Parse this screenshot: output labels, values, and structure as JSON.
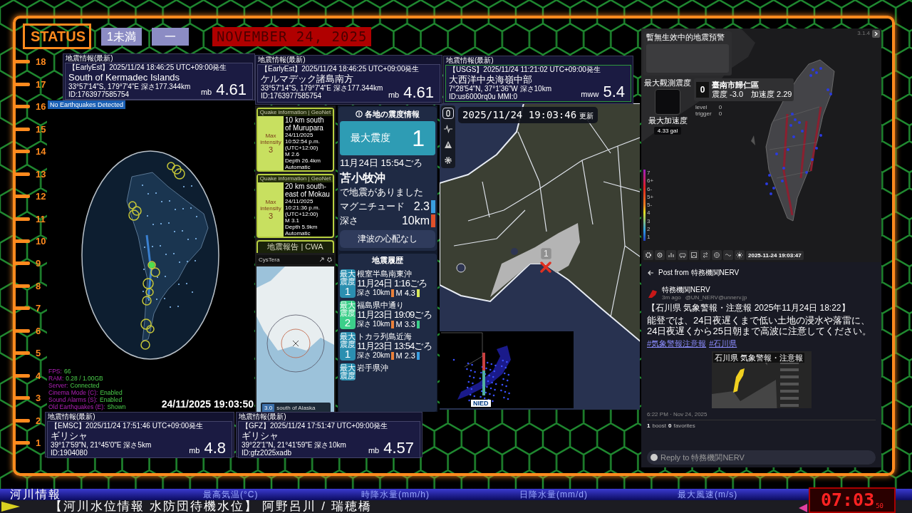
{
  "status": {
    "label": "STATUS",
    "badges": [
      "1未満",
      "一"
    ],
    "date": "NOVEMBER 24, 2025"
  },
  "scale": [
    "18",
    "17",
    "16",
    "15",
    "14",
    "13",
    "12",
    "11",
    "10",
    "9",
    "8",
    "7",
    "6",
    "5",
    "4",
    "3",
    "2",
    "1"
  ],
  "quake_cards": [
    {
      "header": "地震情報(最新)",
      "source_line": "【EarlyEst】2025/11/24 18:46:25 UTC+09:00発生",
      "place": "South of Kermadec Islands",
      "coords": "33°57'14\"S, 179°7'4\"E 深さ177.344km",
      "id": "ID:1763977585754",
      "mag_type": "mb",
      "magnitude": "4.61",
      "highlighted": false
    },
    {
      "header": "地震情報(最新)",
      "source_line": "【EarlyEst】2025/11/24 18:46:25 UTC+09:00発生",
      "place": "ケルマデック諸島南方",
      "coords": "33°57'14\"S, 179°7'4\"E 深さ177.344km",
      "id": "ID:1763977585754",
      "mag_type": "mb",
      "magnitude": "4.61",
      "highlighted": false
    },
    {
      "header": "地震情報(最新)",
      "source_line": "【USGS】2025/11/24 11:21:02 UTC+09:00発生",
      "place": "大西洋中央海嶺中部",
      "coords": "7°28'54\"N, 37°1'36\"W 深さ10km",
      "id": "ID:us6000rq0u MMI:0",
      "mag_type": "mww",
      "magnitude": "5.4",
      "highlighted": true
    },
    {
      "header": "地震情報(最新)",
      "source_line": "【EMSC】2025/11/24 17:51:46 UTC+09:00発生",
      "place": "ギリシャ",
      "coords": "39°17'59\"N, 21°45'0\"E 深さ5km",
      "id": "ID:1904080",
      "mag_type": "mb",
      "magnitude": "4.8",
      "highlighted": false
    },
    {
      "header": "地震情報(最新)",
      "source_line": "【GFZ】2025/11/24 17:51:47 UTC+09:00発生",
      "place": "ギリシャ",
      "coords": "39°22'1\"N, 21°41'59\"E 深さ10km",
      "id": "ID:gfz2025xadb",
      "mag_type": "mb",
      "magnitude": "4.57",
      "highlighted": false
    }
  ],
  "globe": {
    "badge": "No Earthquakes Detected",
    "stats": [
      {
        "label": "FPS:",
        "value": "66"
      },
      {
        "label": "RAM:",
        "value": "0.28 / 1.00GB"
      },
      {
        "label": "Server:",
        "value": "Connected"
      },
      {
        "label": "Cinema Mode (C):",
        "value": "Enabled"
      },
      {
        "label": "Sound Alarms (S):",
        "value": "Enabled"
      },
      {
        "label": "Old Earthquakes (E):",
        "value": "Shown"
      }
    ],
    "timestamp": "24/11/2025 19:03:50"
  },
  "geonet": {
    "cards": [
      {
        "header": "Quake information | GeoNet",
        "intensity_label": "Max intensity",
        "intensity": "3",
        "title": "10 km south of Murupara",
        "datetime": "24/11/2025 10:52:54 p.m.",
        "utc": "(UTC+12:00)",
        "magnitude": "M 2.6",
        "depth": "Depth 26.4km",
        "mode": "Automatic"
      },
      {
        "header": "Quake information | GeoNet",
        "intensity_label": "Max intensity",
        "intensity": "3",
        "title": "20 km south-east of Mokau",
        "datetime": "24/11/2025 10:21:36 p.m.",
        "utc": "(UTC+12:00)",
        "magnitude": "M 3.1",
        "depth": "Depth 5.9km",
        "mode": "Automatic"
      }
    ],
    "cwa_header": "地震報告 | CWA",
    "app_name": "CysTera",
    "map_label": "south of Alaska",
    "map_value": "3.0"
  },
  "jma": {
    "title": "各地の震度情報",
    "max_label": "最大震度",
    "max_value": "1",
    "time": "11月24日 15:54ごろ",
    "place": "苫小牧沖",
    "note": "で地震がありました",
    "magnitude_label": "マグニチュード",
    "magnitude": "2.3",
    "depth_label": "深さ",
    "depth": "10km",
    "tsunami": "津波の心配なし",
    "history_title": "地震履歴",
    "history": [
      {
        "badge_label": "最大震度",
        "intensity": "1",
        "color": "#2b8fb0",
        "place": "根室半島南東沖",
        "time": "11月24日 1:16ごろ",
        "depth_label": "深さ",
        "depth": "10km",
        "magnitude": "M 4.3",
        "mag_bar": {
          "color": "#d8e85a"
        }
      },
      {
        "badge_label": "最大震度",
        "intensity": "2",
        "color": "#3ccf8a",
        "place": "福島県中通り",
        "time": "11月23日 19:09ごろ",
        "depth_label": "深さ",
        "depth": "10km",
        "magnitude": "M 3.3",
        "mag_bar": {
          "color": "#3ccf8a"
        }
      },
      {
        "badge_label": "最大震度",
        "intensity": "1",
        "color": "#2b8fb0",
        "place": "トカラ列島近海",
        "time": "11月23日 13:54ごろ",
        "depth_label": "深さ",
        "depth": "20km",
        "magnitude": "M 2.3",
        "mag_bar": {
          "color": "#3a9ee0"
        }
      },
      {
        "badge_label": "最大震度",
        "color": "#2b8fb0",
        "place": "岩手県沖"
      }
    ]
  },
  "hokkaido": {
    "timestamp": "2025/11/24 19:03:46",
    "updated": "更新",
    "tools": [
      {
        "selected": true
      },
      {
        "selected": false
      },
      {
        "selected": false
      },
      {
        "selected": false
      }
    ],
    "marker_intensity": "1",
    "inset_brand": "NIED"
  },
  "taiwan": {
    "alert_title": "暫無生效中的地震預警",
    "version": "3.1.4",
    "max_intensity_label": "最大觀測震度",
    "station_intensity": "0",
    "station": "臺南市歸仁區",
    "station_detail": "震度 -3.0　加速度 2.29",
    "level_label": "level",
    "level_value": "0",
    "trigger_label": "trigger",
    "trigger_value": "0",
    "max_accel_label": "最大加速度",
    "max_accel": "4.33 gal",
    "legend": [
      "7",
      "6+",
      "6-",
      "5+",
      "5-",
      "4",
      "3",
      "2",
      "1"
    ],
    "timestamp": "2025-11-24 19:03:47"
  },
  "post": {
    "header": "Post from 特務機関NERV",
    "author": "特務機関NERV",
    "meta": "3m ago",
    "handle": "@UN_NERV@unnerv.jp",
    "title": "【石川県 気象警報・注意報 2025年11月24日 18:22】",
    "body": "能登では、24日夜遅くまで低い土地の浸水や落雷に、24日夜遅くから25日朝まで高波に注意してください。",
    "tags": [
      "#気象警報注意報",
      "#石川県"
    ],
    "image_title": "石川県 気象警報・注意報",
    "footer_time": "6:22 PM · Nov 24, 2025",
    "boosts": "1",
    "boosts_label": "boost",
    "favorites": "0",
    "favorites_label": "favorites",
    "reply_placeholder": "Reply to 特務機関NERV"
  },
  "ticker": {
    "title": "河川情報",
    "headings": [
      "最高気温(°C)",
      "時降水量(mm/h)",
      "日降水量(mm/d)",
      "最大風速(m/s)"
    ],
    "message": "【河川水位情報 水防団待機水位】 阿野呂川 / 瑞穂橋",
    "clock": "07:03",
    "seconds": "50"
  }
}
